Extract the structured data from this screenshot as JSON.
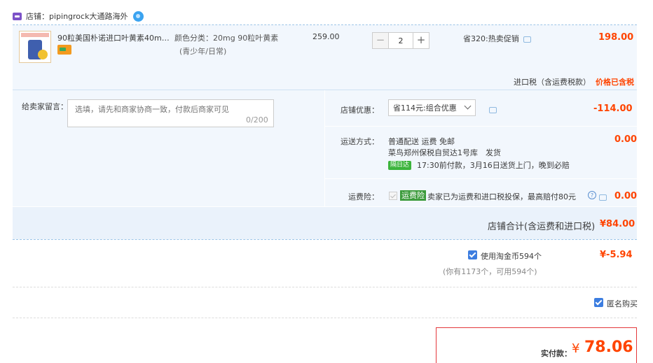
{
  "store": {
    "label": "店铺：pipingrock大通路海外",
    "icon": "store-icon",
    "chat_icon": "wangwang-icon"
  },
  "product": {
    "title": "90粒美国朴诺进口叶黄素40mg...",
    "sku_line1": "颜色分类：20mg 90粒叶黄素",
    "sku_line2": "(青少年/日常)",
    "unit_price": "259.00",
    "quantity": "2",
    "minus": "−",
    "plus": "+",
    "promo": "省320:热卖促销",
    "row_total": "198.00",
    "thumb_alt": "product-thumbnail"
  },
  "tax": {
    "label": "进口税（含运费税款）",
    "value": "价格已含税"
  },
  "message": {
    "label": "给卖家留言：",
    "placeholder": "选填，请先和商家协商一致，付款后商家可见",
    "count": "0/200"
  },
  "coupon": {
    "label": "店铺优惠：",
    "selected": "省114元:组合优惠",
    "value": "-114.00"
  },
  "shipping": {
    "label": "运送方式：",
    "line1": "普通配送 运费 免邮",
    "line2": "菜鸟郑州保税自贸达1号库　发货",
    "badge": "隔日达",
    "line3": "17:30前付款，3月16日送货上门，晚到必赔",
    "value": "0.00"
  },
  "insurance": {
    "label": "运费险：",
    "badge": "运费险",
    "text": "卖家已为运费和进口税投保，最高赔付80元",
    "help": "?",
    "value": "0.00"
  },
  "store_total": {
    "label": "店铺合计(含运费和进口税)",
    "value": "¥84.00"
  },
  "taobao_coin": {
    "label": "使用淘金币594个",
    "value": "¥-5.94",
    "sub": "(你有1173个，可用594个)",
    "checked": true
  },
  "anonymous": {
    "label": "匿名购买",
    "checked": true
  },
  "payment": {
    "label": "实付款：",
    "currency": "¥",
    "value": "78.06"
  },
  "colors": {
    "price_red": "#ff4400",
    "accent_blue": "#3c7de0",
    "panel_bg": "#f2f7fd"
  }
}
